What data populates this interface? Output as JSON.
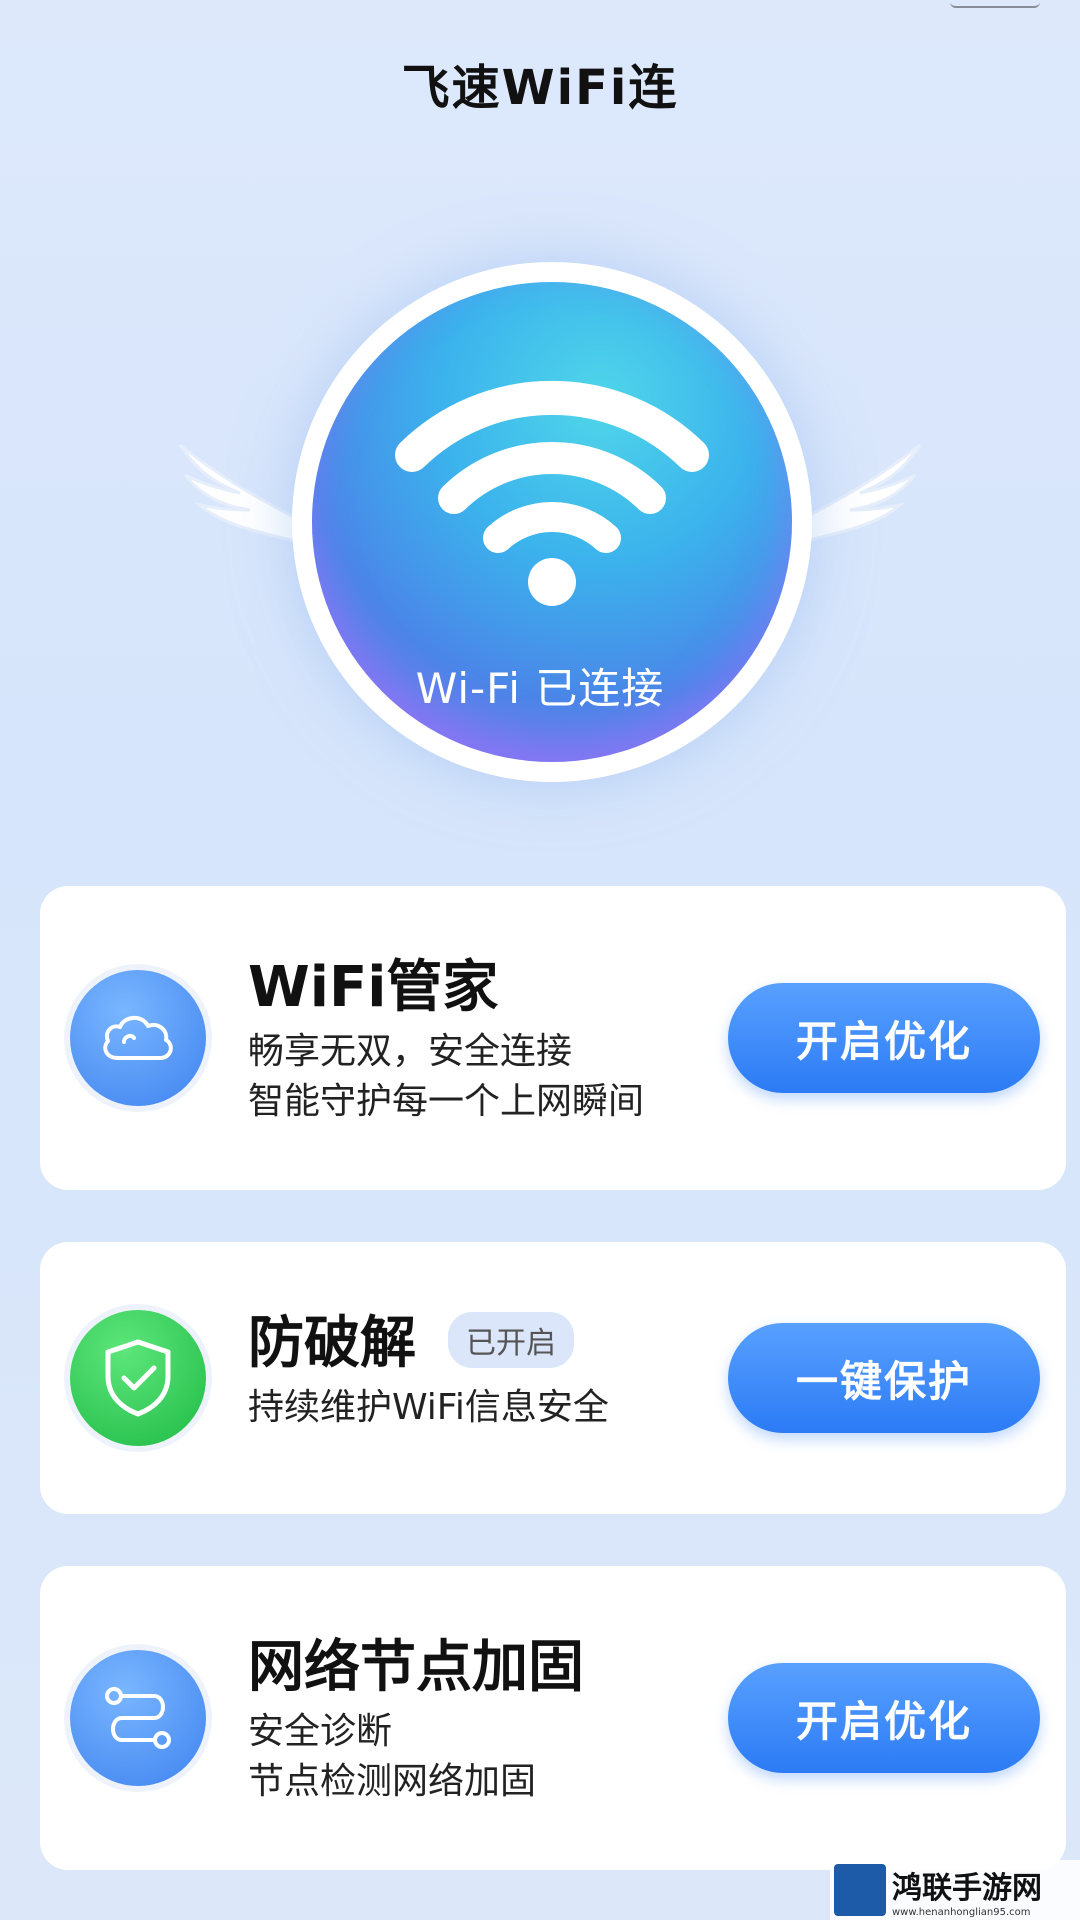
{
  "app": {
    "title": "飞速WiFi连"
  },
  "hero": {
    "status_label": "Wi-Fi 已连接"
  },
  "cards": [
    {
      "title": "WiFi管家",
      "lines": [
        "畅享无双，安全连接",
        "智能守护每一个上网瞬间"
      ],
      "button": "开启优化",
      "icon": "cloud-icon"
    },
    {
      "title": "防破解",
      "badge": "已开启",
      "lines": [
        "持续维护WiFi信息安全"
      ],
      "button": "一键保护",
      "icon": "shield-check-icon"
    },
    {
      "title": "网络节点加固",
      "lines": [
        "安全诊断",
        "节点检测网络加固"
      ],
      "button": "开启优化",
      "icon": "route-nodes-icon"
    }
  ],
  "watermark": {
    "name": "鸿联手游网",
    "url": "www.henanhonglian95.com"
  },
  "colors": {
    "accent": "#2c7bf5",
    "green": "#1fba46"
  }
}
